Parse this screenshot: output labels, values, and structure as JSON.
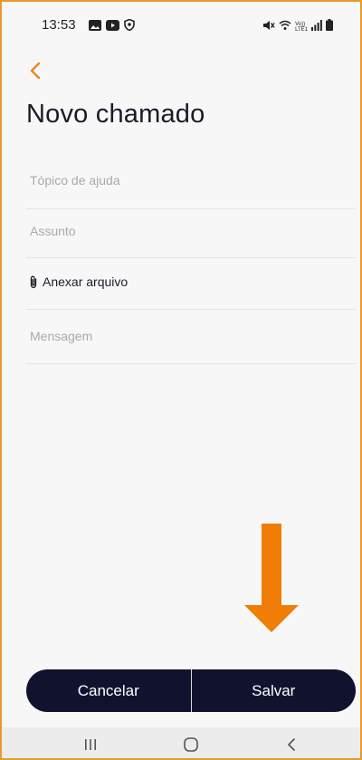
{
  "status_bar": {
    "time": "13:53",
    "left_icons": [
      "gallery-icon",
      "youtube-icon",
      "shield-icon"
    ],
    "right_icons": [
      "mute-icon",
      "wifi-icon",
      "volte-lte-icon",
      "signal-icon",
      "battery-icon"
    ],
    "volte_text": "Vo))",
    "lte_text": "LTE1"
  },
  "header": {
    "back_icon": "chevron-left-icon",
    "title": "Novo chamado"
  },
  "form": {
    "topic_placeholder": "Tópico de ajuda",
    "subject_placeholder": "Assunto",
    "attach_icon": "paperclip-icon",
    "attach_label": "Anexar arquivo",
    "message_placeholder": "Mensagem"
  },
  "annotation": {
    "arrow_icon": "down-arrow-icon"
  },
  "actions": {
    "cancel_label": "Cancelar",
    "save_label": "Salvar"
  },
  "nav_bar": {
    "items": [
      "recent-apps-icon",
      "home-icon",
      "back-icon"
    ]
  },
  "colors": {
    "accent": "#e8871e",
    "frame_border": "#e89a2c",
    "button_bg": "#11132e",
    "button_text": "#ffffff",
    "placeholder": "#a9a9b0",
    "divider": "#e4e4e4",
    "arrow": "#f07d05"
  }
}
